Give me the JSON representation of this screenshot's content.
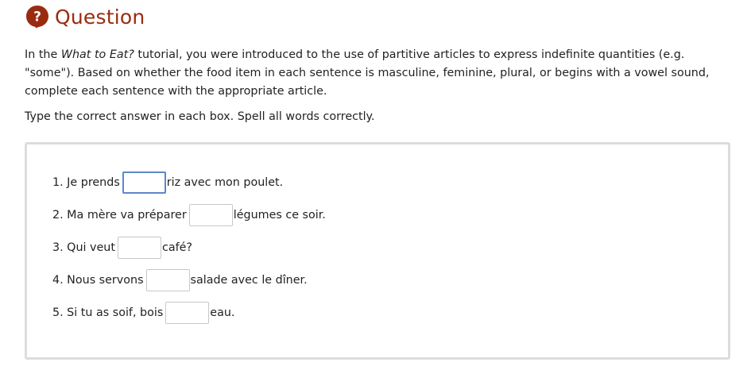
{
  "header": {
    "icon": "question-circle-icon",
    "icon_glyph": "?",
    "title": "Question",
    "accent_color": "#9a2b10"
  },
  "intro": {
    "prefix": "In the ",
    "tutorial_name": "What to Eat?",
    "suffix": " tutorial, you were introduced to the use of partitive articles to express indefinite quantities (e.g. \"some\"). Based on whether the food item in each sentence is masculine, feminine, plural, or begins with a vowel sound, complete each sentence with the appropriate article."
  },
  "instruction": "Type the correct answer in each box. Spell all words correctly.",
  "items": [
    {
      "before": "1. Je prends",
      "value": "",
      "after": "riz avec mon poulet."
    },
    {
      "before": "2. Ma mère va préparer",
      "value": "",
      "after": "légumes ce soir."
    },
    {
      "before": "3. Qui veut",
      "value": "",
      "after": "café?"
    },
    {
      "before": "4. Nous servons",
      "value": "",
      "after": "salade avec le dîner."
    },
    {
      "before": "5. Si tu as soif, bois",
      "value": "",
      "after": "eau."
    }
  ]
}
